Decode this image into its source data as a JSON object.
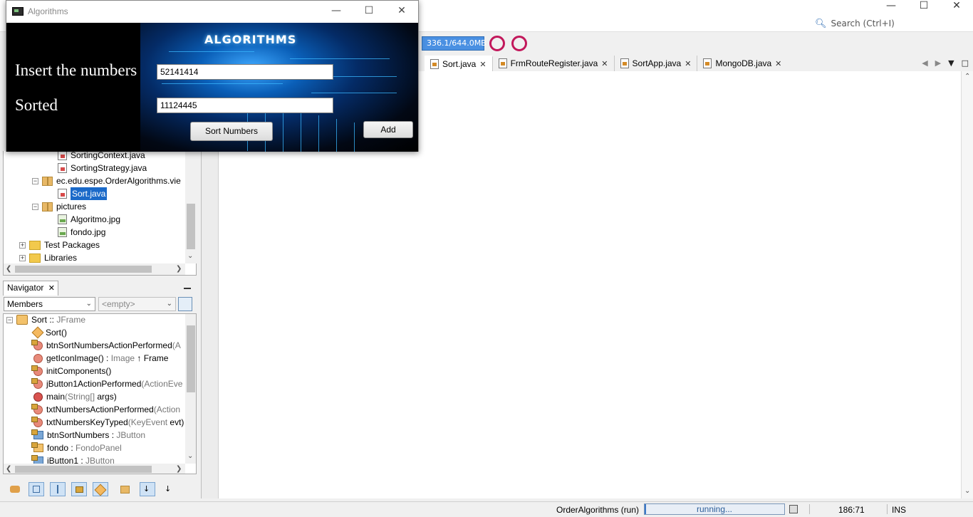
{
  "ide": {
    "search_placeholder": "Search (Ctrl+I)",
    "memory": "336.1/644.0MB",
    "tabs": [
      {
        "label": "Sort.java"
      },
      {
        "label": "FrmRouteRegister.java"
      },
      {
        "label": "SortApp.java"
      },
      {
        "label": "MongoDB.java"
      }
    ]
  },
  "projects": {
    "items": [
      {
        "label": "SortingContext.java"
      },
      {
        "label": "SortingStrategy.java"
      },
      {
        "label": "ec.edu.espe.OrderAlgorithms.vie"
      },
      {
        "label": "Sort.java"
      },
      {
        "label": "pictures"
      },
      {
        "label": "Algoritmo.jpg"
      },
      {
        "label": "fondo.jpg"
      },
      {
        "label": "Test Packages"
      },
      {
        "label": "Libraries"
      }
    ]
  },
  "navigator": {
    "tab_label": "Navigator",
    "filter_selected": "Members",
    "scope_selected": "<empty>",
    "root": {
      "name": "Sort",
      "sep": " :: ",
      "type": "JFrame"
    },
    "members": [
      {
        "name": "Sort()",
        "detail": ""
      },
      {
        "name": "btnSortNumbersActionPerformed",
        "detail": "(A"
      },
      {
        "name": "getIconImage() : ",
        "detail": "Image",
        "extra": " ↑ Frame"
      },
      {
        "name": "initComponents()",
        "detail": ""
      },
      {
        "name": "jButton1ActionPerformed",
        "detail": "(ActionEve"
      },
      {
        "name": "main",
        "detail": "(String[] ",
        "extra": "args)"
      },
      {
        "name": "txtNumbersActionPerformed",
        "detail": "(Action"
      },
      {
        "name": "txtNumbersKeyTyped",
        "detail": "(KeyEvent ",
        "extra": "evt)"
      },
      {
        "name": "btnSortNumbers : ",
        "detail": "JButton"
      },
      {
        "name": "fondo : ",
        "detail": "FondoPanel"
      },
      {
        "name": "jButton1 : ",
        "detail": "JButton"
      }
    ]
  },
  "statusbar": {
    "project": "OrderAlgorithms (run)",
    "progress": "running...",
    "position": "186:71",
    "mode": "INS"
  },
  "app": {
    "title": "Algorithms",
    "heading": "ALGORITHMS",
    "insert_label": "Insert the numbers",
    "insert_value": "52141414",
    "sorted_label": "Sorted",
    "sorted_value": "11124445",
    "sort_button": "Sort Numbers",
    "add_button": "Add"
  },
  "colors": {
    "selection": "#1b6ac9",
    "memory_bar": "#4a90e2",
    "profiler_icon": "#c2185b"
  }
}
